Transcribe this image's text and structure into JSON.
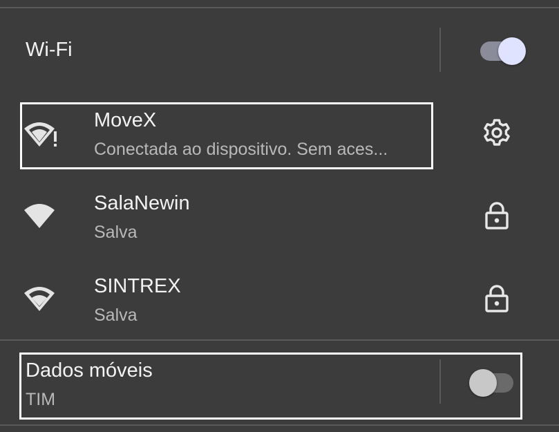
{
  "wifi": {
    "title": "Wi-Fi",
    "enabled": true
  },
  "networks": [
    {
      "name": "MoveX",
      "status": "Conectada ao dispositivo. Sem aces...",
      "icon": "wifi-warning-icon",
      "trailing_icon": "gear-icon"
    },
    {
      "name": "SalaNewin",
      "status": "Salva",
      "icon": "wifi-full-icon",
      "trailing_icon": "lock-icon"
    },
    {
      "name": "SINTREX",
      "status": "Salva",
      "icon": "wifi-partial-icon",
      "trailing_icon": "lock-icon"
    }
  ],
  "mobile_data": {
    "title": "Dados móveis",
    "carrier": "TIM",
    "enabled": false
  },
  "colors": {
    "background": "#3c3c3c",
    "toggle_on_thumb": "#dfe3ff",
    "toggle_on_track": "#8a8c9a",
    "toggle_off_thumb": "#c8c8c8",
    "toggle_off_track": "#6a6a6a",
    "highlight_border": "#ffffff"
  }
}
